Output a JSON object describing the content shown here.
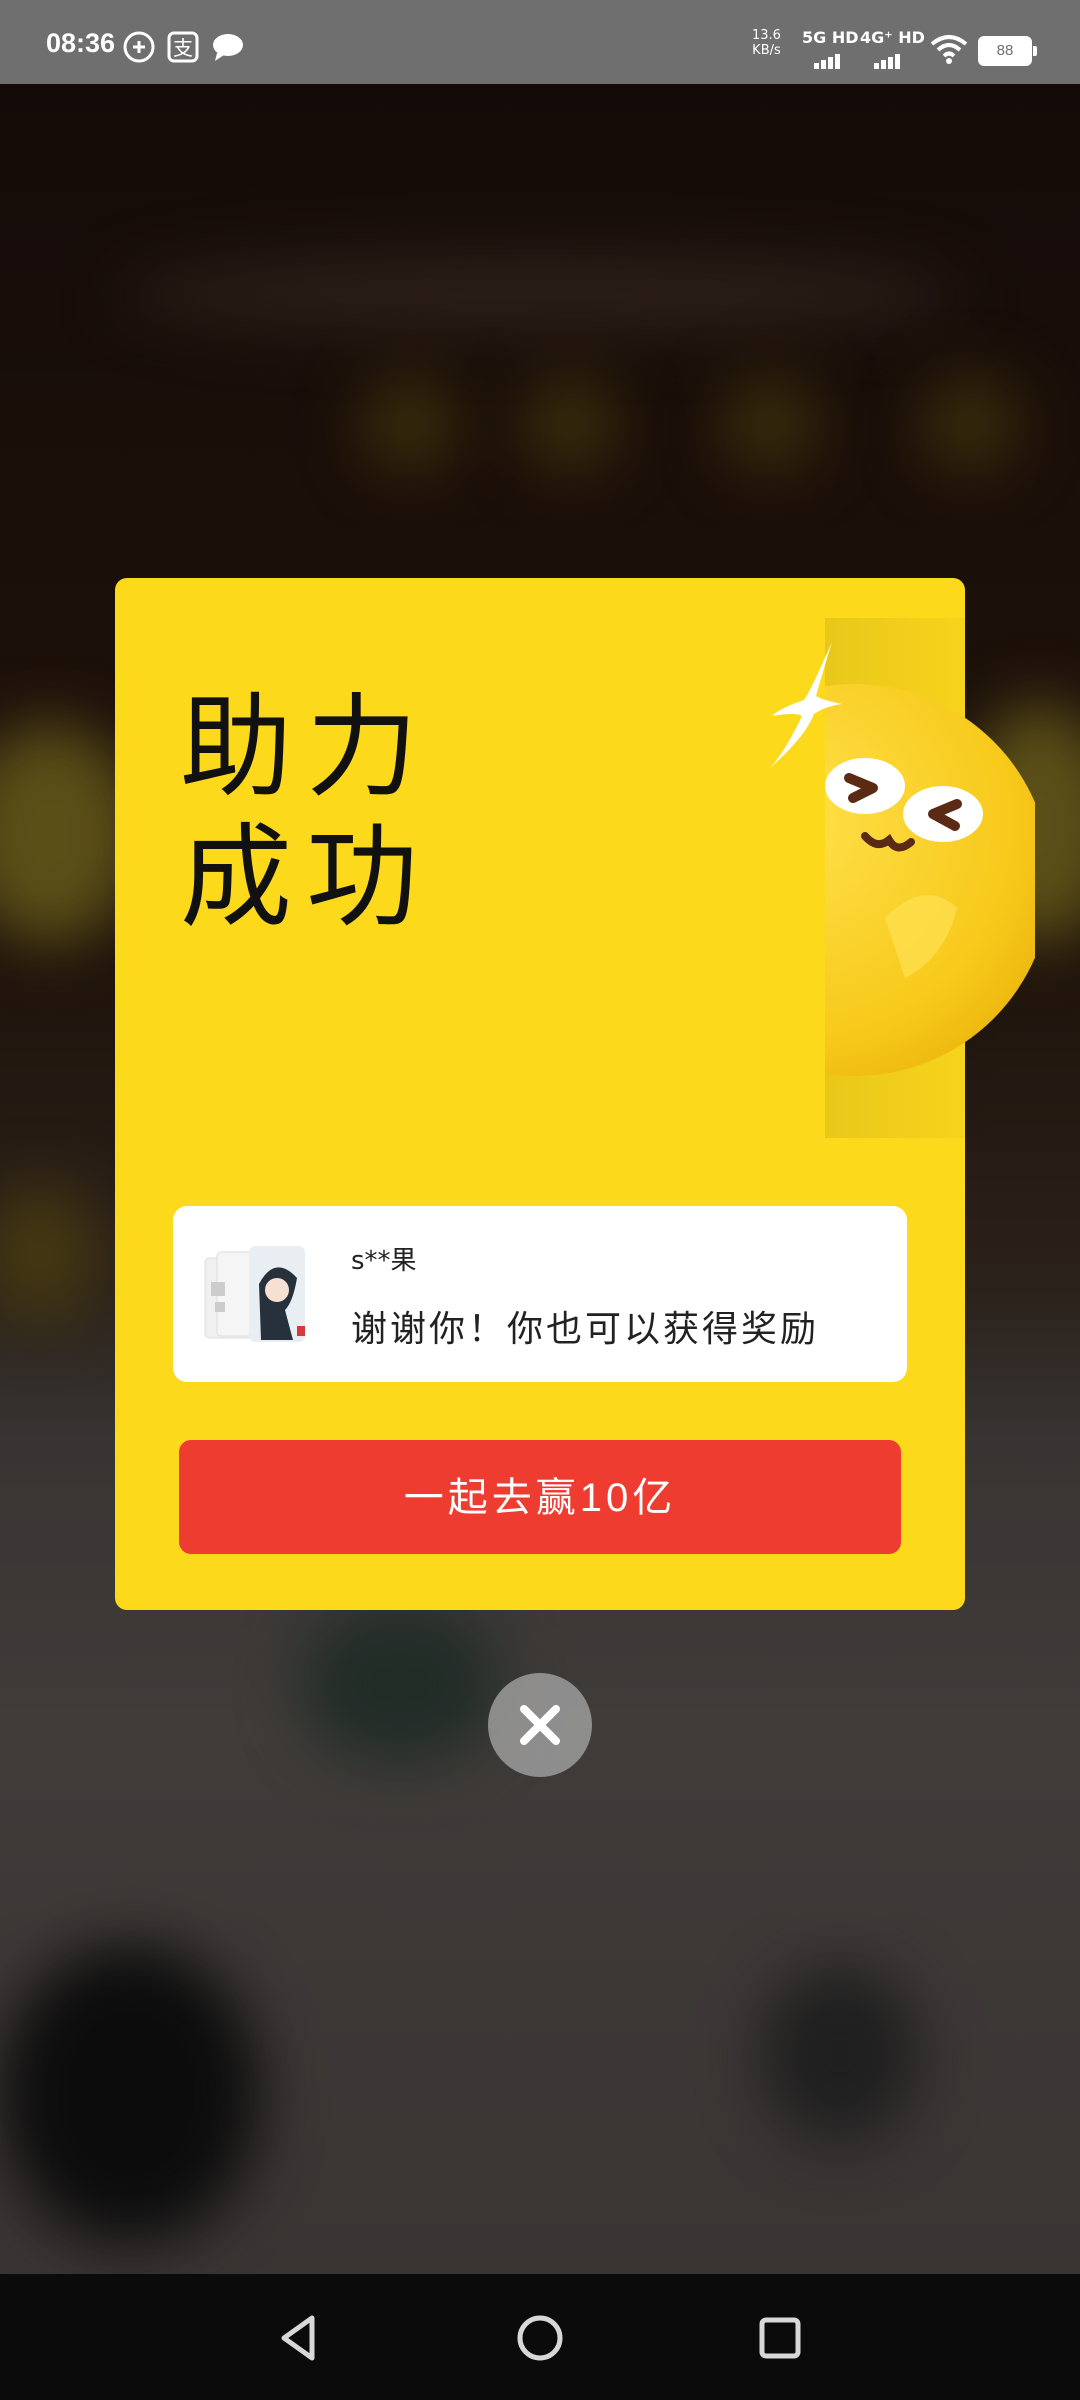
{
  "status_bar": {
    "time": "08:36",
    "net_speed_value": "13.6",
    "net_speed_unit": "KB/s",
    "signal1_label": "5G HD",
    "signal2_label": "4G⁺ HD",
    "battery": "88",
    "icons": [
      "plus-circle-icon",
      "alipay-icon",
      "message-icon",
      "wifi-icon",
      "battery-icon"
    ]
  },
  "dialog": {
    "title_line1": "助力",
    "title_line2": "成功",
    "message_card": {
      "user_name": "s**果",
      "message": "谢谢你！你也可以获得奖励"
    },
    "cta_label": "一起去赢10亿",
    "colors": {
      "card_bg": "#fdd91c",
      "cta_bg": "#ee3c31"
    }
  },
  "close_icon": "close-icon",
  "nav_bar": {
    "icons": [
      "back-icon",
      "home-icon",
      "recents-icon"
    ]
  }
}
